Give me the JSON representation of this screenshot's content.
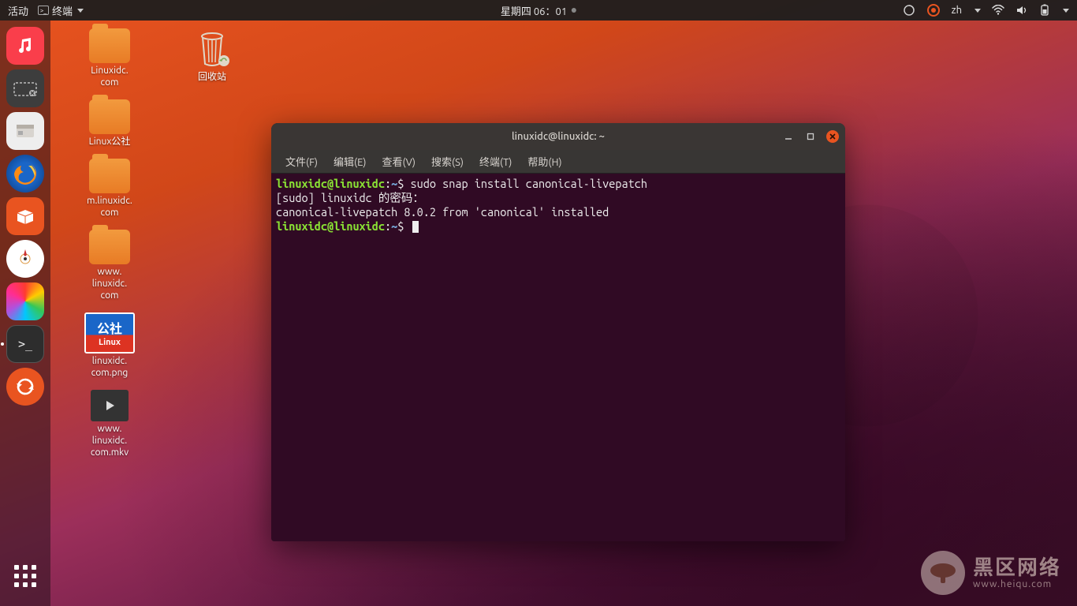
{
  "topbar": {
    "activities": "活动",
    "app_label": "终端",
    "clock": "星期四 06：01"
  },
  "input_method": "zh",
  "dock": {
    "items": [
      {
        "name": "music",
        "bg": "#e24a33"
      },
      {
        "name": "screenshot",
        "bg": "#4a4a4a"
      },
      {
        "name": "files",
        "bg": "#e8e8e8"
      },
      {
        "name": "firefox",
        "bg": "#1a66c8"
      },
      {
        "name": "software",
        "bg": "#e95420"
      },
      {
        "name": "utilities",
        "bg": "#ffffff"
      },
      {
        "name": "colors",
        "bg": "linear"
      },
      {
        "name": "terminal",
        "bg": "#2d2d2d"
      },
      {
        "name": "updates",
        "bg": "#e95420"
      }
    ]
  },
  "desktop_icons": {
    "col1": [
      {
        "type": "folder",
        "label": "Linuxidc.\ncom"
      },
      {
        "type": "folder",
        "label": "Linux公社"
      },
      {
        "type": "folder",
        "label": "m.linuxidc.\ncom"
      },
      {
        "type": "folder",
        "label": "www.\nlinuxidc.\ncom"
      },
      {
        "type": "image",
        "label": "linuxidc.\ncom.png",
        "thumb_top": "公社",
        "thumb_bot": "Linux"
      },
      {
        "type": "video",
        "label": "www.\nlinuxidc.\ncom.mkv"
      }
    ],
    "col2": [
      {
        "type": "trash",
        "label": "回收站"
      }
    ]
  },
  "window": {
    "title": "linuxidc@linuxidc: ~",
    "menu": [
      "文件(F)",
      "编辑(E)",
      "查看(V)",
      "搜索(S)",
      "终端(T)",
      "帮助(H)"
    ]
  },
  "terminal": {
    "prompt_user": "linuxidc@linuxidc",
    "prompt_path": "~",
    "lines": [
      {
        "prompt": true,
        "cmd": "sudo snap install canonical-livepatch"
      },
      {
        "plain": "[sudo] linuxidc 的密码："
      },
      {
        "plain": "canonical-livepatch 8.0.2 from 'canonical' installed"
      },
      {
        "prompt": true,
        "cmd": "",
        "cursor": true
      }
    ]
  },
  "watermark": {
    "title": "黑区网络",
    "subtitle": "www.heiqu.com"
  }
}
